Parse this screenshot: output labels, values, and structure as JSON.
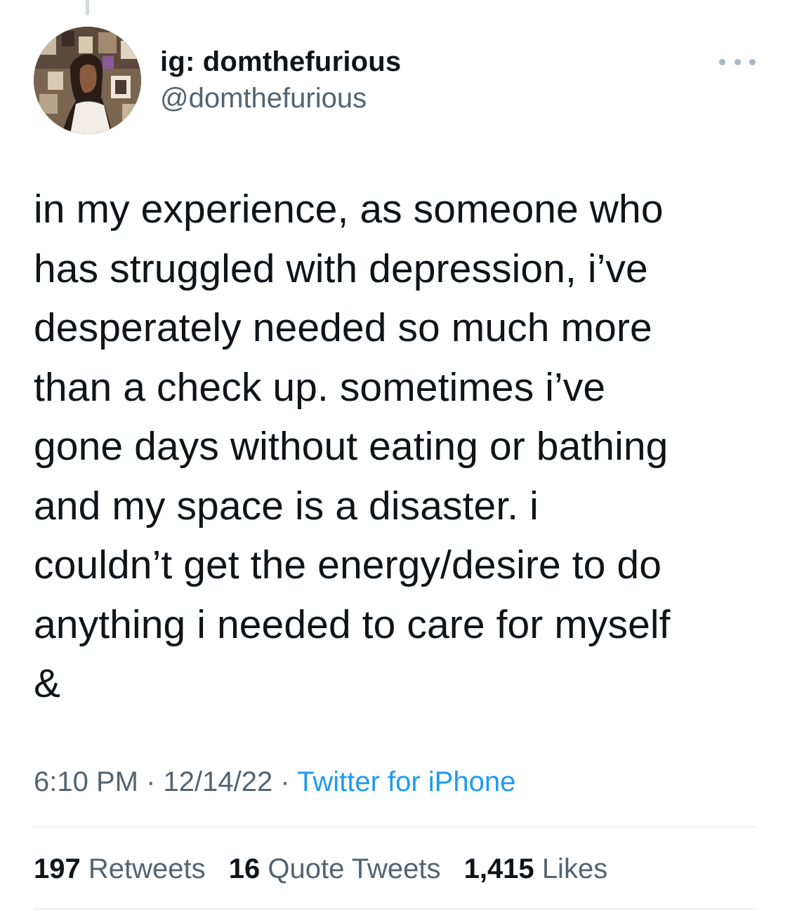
{
  "tweet": {
    "author": {
      "display_name": "ig: domthefurious",
      "handle": "@domthefurious"
    },
    "text": "in my experience, as someone who\nhas struggled with depression, i’ve\ndesperately needed so much more\nthan a check up. sometimes i’ve\ngone days without eating or bathing\nand my space is a disaster. i\ncouldn’t get the energy/desire to do\nanything i needed to care for myself\n&",
    "time": "6:10 PM",
    "separator": "·",
    "date": "12/14/22",
    "source": "Twitter for iPhone",
    "stats": [
      {
        "count": "197",
        "label": "Retweets"
      },
      {
        "count": "16",
        "label": "Quote Tweets"
      },
      {
        "count": "1,415",
        "label": "Likes"
      }
    ]
  },
  "colors": {
    "text": "#0f1419",
    "secondary": "#536471",
    "link": "#1d9bf0",
    "divider": "#eff3f4"
  },
  "icons": {
    "more": "more-horizontal-icon"
  }
}
